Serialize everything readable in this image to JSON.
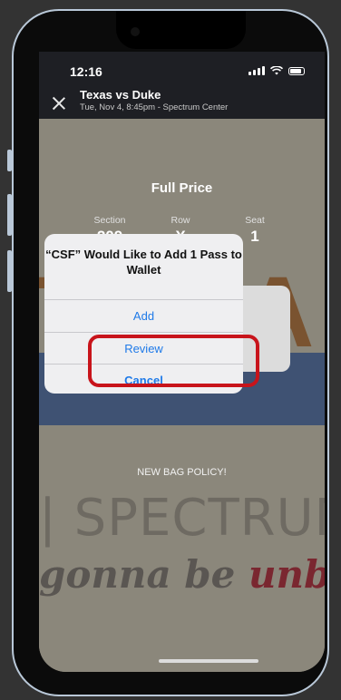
{
  "status": {
    "time": "12:16"
  },
  "nav": {
    "title": "Texas vs Duke",
    "subtitle": "Tue, Nov 4, 8:45pm - Spectrum Center"
  },
  "ticket": {
    "price_label": "Full Price",
    "section": {
      "label": "Section",
      "value": "209"
    },
    "row": {
      "label": "Row",
      "value": "X"
    },
    "seat": {
      "label": "Seat",
      "value": "1"
    },
    "bag_policy": "NEW BAG POLICY!"
  },
  "poster": {
    "line1": "TEXA",
    "line2": "| SPECTRUM C",
    "line3_a": "gonna be ",
    "line3_b": "unbeli"
  },
  "alert": {
    "title": "“CSF” Would Like to Add 1 Pass to Wallet",
    "add_label": "Add",
    "review_label": "Review",
    "cancel_label": "Cancel"
  },
  "colors": {
    "accent": "#1f7ae8",
    "highlight": "#c8141b",
    "bar": "#1e1f24"
  }
}
